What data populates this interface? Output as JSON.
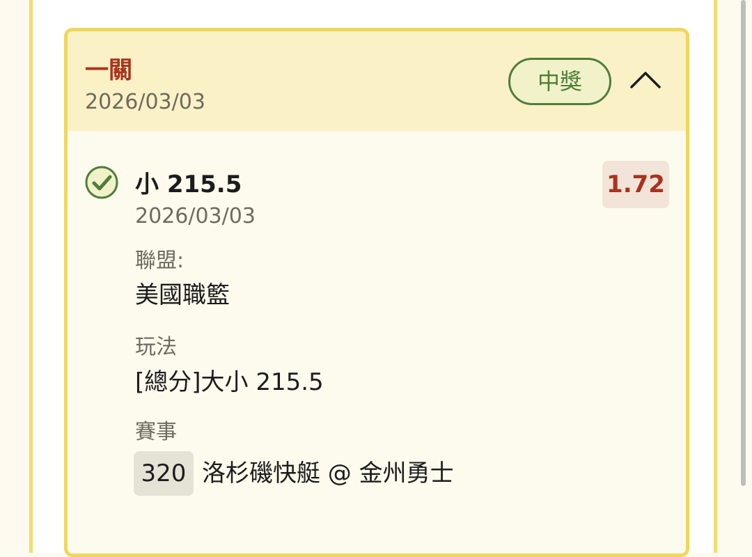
{
  "bet": {
    "type": "一關",
    "date": "2026/03/03",
    "status": "中獎",
    "expanded": true
  },
  "selection": {
    "label": "小 215.5",
    "date": "2026/03/03",
    "odds": "1.72",
    "result": "won"
  },
  "details": {
    "league_label": "聯盟:",
    "league_value": "美國職籃",
    "market_label": "玩法",
    "market_value": "[總分]大小 215.5",
    "event_label": "賽事",
    "event_number": "320",
    "event_name": "洛杉磯快艇 @ 金州勇士"
  },
  "icons": {
    "collapse": "chevron-up-icon",
    "result": "check-circle-icon"
  },
  "colors": {
    "accent_red": "#a8331f",
    "won_green": "#4f7d39",
    "card_border": "#f0d75a",
    "header_bg": "#faf1c6"
  }
}
